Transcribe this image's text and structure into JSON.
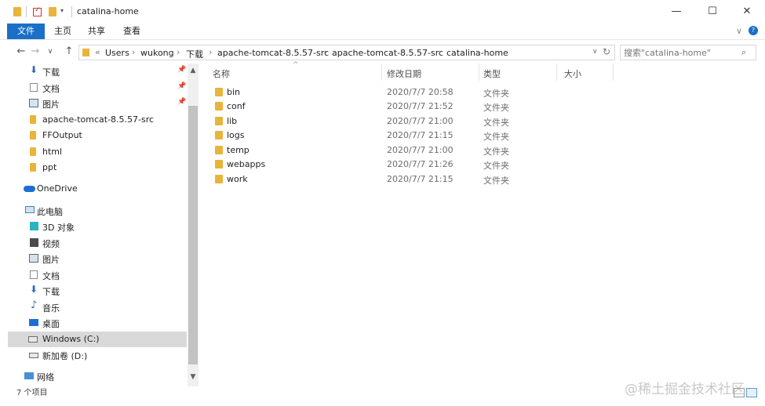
{
  "window": {
    "title": "catalina-home",
    "controls": {
      "minimize": "—",
      "maximize": "☐",
      "close": "✕"
    }
  },
  "ribbon": {
    "tabs": [
      "文件",
      "主页",
      "共享",
      "查看"
    ],
    "expand_icon": "chevron-down-icon",
    "help_icon": "help-icon"
  },
  "address": {
    "prefix": "«",
    "crumbs": [
      "Users",
      "wukong",
      "下载",
      "apache-tomcat-8.5.57-src",
      "apache-tomcat-8.5.57-src",
      "catalina-home"
    ],
    "separator": "›"
  },
  "search": {
    "placeholder": "搜索\"catalina-home\""
  },
  "nav": {
    "quick_access": [
      {
        "label": "下载",
        "icon": "download-arrow-icon",
        "pinned": true
      },
      {
        "label": "文档",
        "icon": "document-icon",
        "pinned": true
      },
      {
        "label": "图片",
        "icon": "picture-icon",
        "pinned": true
      },
      {
        "label": "apache-tomcat-8.5.57-src",
        "icon": "folder-icon",
        "pinned": false
      },
      {
        "label": "FFOutput",
        "icon": "folder-icon",
        "pinned": false
      },
      {
        "label": "html",
        "icon": "folder-icon",
        "pinned": false
      },
      {
        "label": "ppt",
        "icon": "folder-icon",
        "pinned": false
      }
    ],
    "onedrive": "OneDrive",
    "this_pc": "此电脑",
    "pc_items": [
      {
        "label": "3D 对象",
        "icon": "cube-3d-icon"
      },
      {
        "label": "视频",
        "icon": "video-icon"
      },
      {
        "label": "图片",
        "icon": "picture-icon"
      },
      {
        "label": "文档",
        "icon": "document-icon"
      },
      {
        "label": "下载",
        "icon": "download-arrow-icon"
      },
      {
        "label": "音乐",
        "icon": "music-note-icon"
      },
      {
        "label": "桌面",
        "icon": "desktop-icon"
      },
      {
        "label": "Windows (C:)",
        "icon": "system-drive-icon",
        "selected": true
      },
      {
        "label": "新加卷 (D:)",
        "icon": "drive-icon"
      }
    ],
    "network": "网络"
  },
  "columns": {
    "name": "名称",
    "modified": "修改日期",
    "type": "类型",
    "size": "大小"
  },
  "files": [
    {
      "name": "bin",
      "modified": "2020/7/7 20:58",
      "type": "文件夹"
    },
    {
      "name": "conf",
      "modified": "2020/7/7 21:52",
      "type": "文件夹"
    },
    {
      "name": "lib",
      "modified": "2020/7/7 21:00",
      "type": "文件夹"
    },
    {
      "name": "logs",
      "modified": "2020/7/7 21:15",
      "type": "文件夹"
    },
    {
      "name": "temp",
      "modified": "2020/7/7 21:00",
      "type": "文件夹"
    },
    {
      "name": "webapps",
      "modified": "2020/7/7 21:26",
      "type": "文件夹"
    },
    {
      "name": "work",
      "modified": "2020/7/7 21:15",
      "type": "文件夹"
    }
  ],
  "status": {
    "item_count": "7 个项目"
  },
  "watermark": "@稀土掘金技术社区",
  "colors": {
    "accent": "#1a6fc7",
    "folder": "#e8b53a",
    "selected": "#d9d9d9"
  }
}
